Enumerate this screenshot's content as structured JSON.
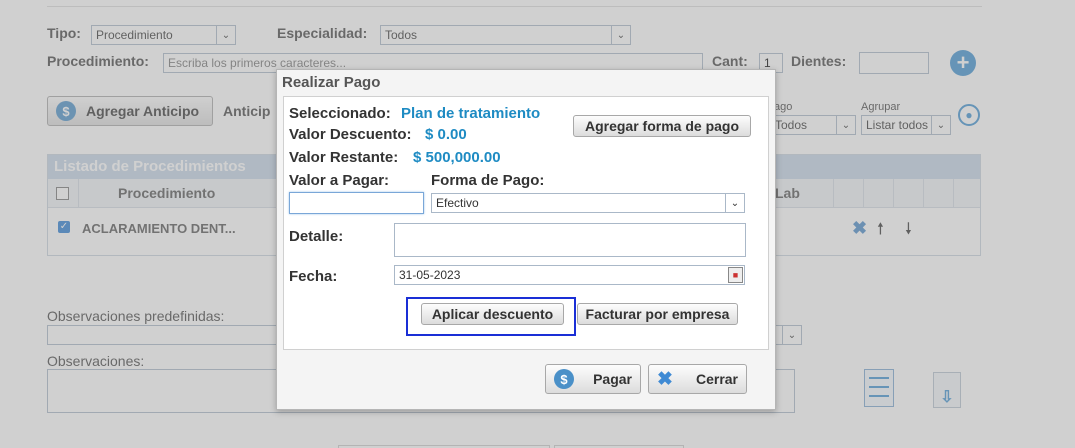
{
  "form": {
    "tipo_label": "Tipo:",
    "tipo_value": "Procedimiento",
    "especialidad_label": "Especialidad:",
    "especialidad_value": "Todos",
    "procedimiento_label": "Procedimiento:",
    "procedimiento_placeholder": "Escriba los primeros caracteres...",
    "cant_label": "Cant:",
    "cant_value": "1",
    "dientes_label": "Dientes:",
    "agregar_anticipo": "Agregar Anticipo",
    "anticipo_partial": "Anticip",
    "pago_label_partial": "ago",
    "pago_value_partial": "Todos",
    "agrupar_label": "Agrupar",
    "agrupar_value": "Listar todos"
  },
  "table": {
    "title": "Listado de Procedimientos",
    "col_procedimiento": "Procedimiento",
    "col_lab_partial": "Lab",
    "row_name": "ACLARAMIENTO DENT..."
  },
  "bottom": {
    "obs_predef_label": "Observaciones predefinidas:",
    "obs_label": "Observaciones:"
  },
  "dialog": {
    "title": "Realizar Pago",
    "seleccionado_label": "Seleccionado:",
    "seleccionado_value": "Plan de tratamiento",
    "valor_descuento_label": "Valor Descuento:",
    "valor_descuento_value": "$ 0.00",
    "valor_restante_label": "Valor Restante:",
    "valor_restante_value": "$ 500,000.00",
    "agregar_forma_pago": "Agregar forma de pago",
    "valor_pagar_label": "Valor a Pagar:",
    "forma_pago_label": "Forma de Pago:",
    "forma_pago_value": "Efectivo",
    "detalle_label": "Detalle:",
    "fecha_label": "Fecha:",
    "fecha_value": "31-05-2023",
    "aplicar_descuento": "Aplicar descuento",
    "facturar_empresa": "Facturar por empresa",
    "pagar": "Pagar",
    "cerrar": "Cerrar"
  },
  "colors": {
    "accent_blue": "#1e8bc3",
    "focus_outline": "#1a2fd6",
    "table_header": "#c5d6e8"
  }
}
